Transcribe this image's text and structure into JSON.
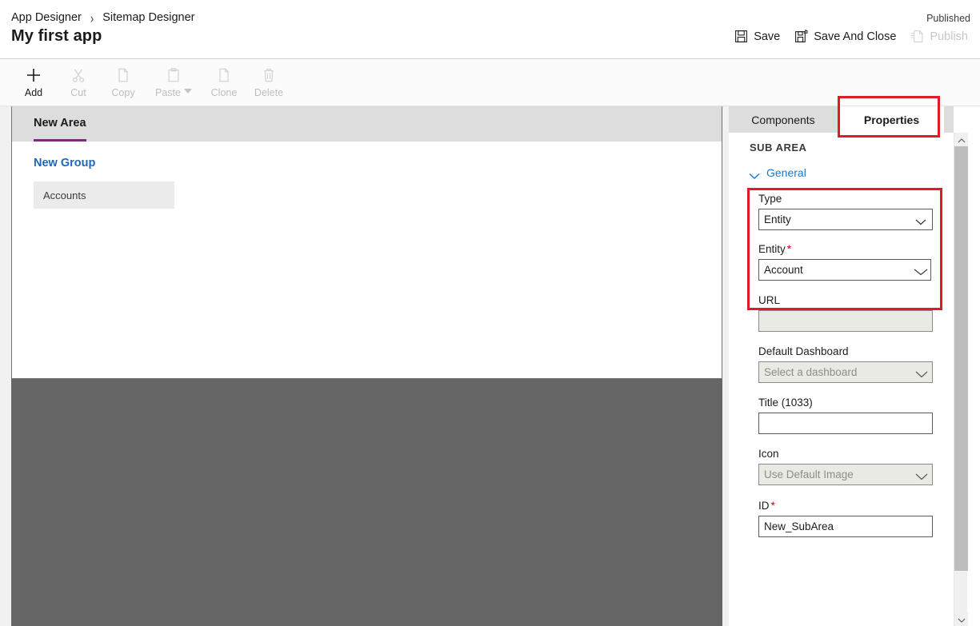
{
  "header": {
    "breadcrumb": [
      "App Designer",
      "Sitemap Designer"
    ],
    "breadcrumb_separator": "›",
    "app_title": "My first app",
    "published_status": "Published",
    "actions": [
      {
        "label": "Save",
        "icon": "save-icon",
        "enabled": true
      },
      {
        "label": "Save And Close",
        "icon": "save-and-close-icon",
        "enabled": true
      },
      {
        "label": "Publish",
        "icon": "publish-icon",
        "enabled": false
      }
    ]
  },
  "toolbar": {
    "items": [
      {
        "label": "Add",
        "icon": "plus-icon",
        "enabled": true,
        "has_caret": false
      },
      {
        "label": "Cut",
        "icon": "scissors-icon",
        "enabled": false,
        "has_caret": false
      },
      {
        "label": "Copy",
        "icon": "copy-icon",
        "enabled": false,
        "has_caret": false
      },
      {
        "label": "Paste",
        "icon": "clipboard-icon",
        "enabled": false,
        "has_caret": true
      },
      {
        "label": "Clone",
        "icon": "clone-icon",
        "enabled": false,
        "has_caret": false
      },
      {
        "label": "Delete",
        "icon": "trash-icon",
        "enabled": false,
        "has_caret": false
      }
    ]
  },
  "canvas": {
    "area_tab": "New Area",
    "group_title": "New Group",
    "subareas": [
      "Accounts"
    ]
  },
  "panel": {
    "tabs": [
      {
        "label": "Components",
        "selected": false
      },
      {
        "label": "Properties",
        "selected": true
      }
    ],
    "section_heading": "SUB AREA",
    "general_section": {
      "label": "General",
      "expanded": true,
      "icon": "chevron-down-icon"
    },
    "fields": [
      {
        "label": "Type",
        "required": false,
        "control": "select",
        "value": "Entity",
        "disabled": false,
        "placeholder": ""
      },
      {
        "label": "Entity",
        "required": true,
        "control": "select",
        "value": "Account",
        "disabled": false,
        "placeholder": ""
      },
      {
        "label": "URL",
        "required": false,
        "control": "text",
        "value": "",
        "disabled": true,
        "placeholder": ""
      },
      {
        "label": "Default Dashboard",
        "required": false,
        "control": "select",
        "value": "",
        "disabled": true,
        "placeholder": "Select a dashboard"
      },
      {
        "label": "Title (1033)",
        "required": false,
        "control": "text",
        "value": "",
        "disabled": false,
        "placeholder": ""
      },
      {
        "label": "Icon",
        "required": false,
        "control": "select",
        "value": "",
        "disabled": true,
        "placeholder": "Use Default Image"
      },
      {
        "label": "ID",
        "required": true,
        "control": "text",
        "value": "New_SubArea",
        "disabled": false,
        "placeholder": ""
      }
    ],
    "scrollbar": {
      "up_icon": "chevron-up-icon",
      "down_icon": "chevron-down-icon"
    }
  },
  "annotations": {
    "highlight_color": "#e01b24",
    "boxes": [
      {
        "name": "properties-tab-highlight",
        "target": "Properties"
      },
      {
        "name": "type-entity-highlight",
        "target": "Type / Entity"
      }
    ]
  }
}
